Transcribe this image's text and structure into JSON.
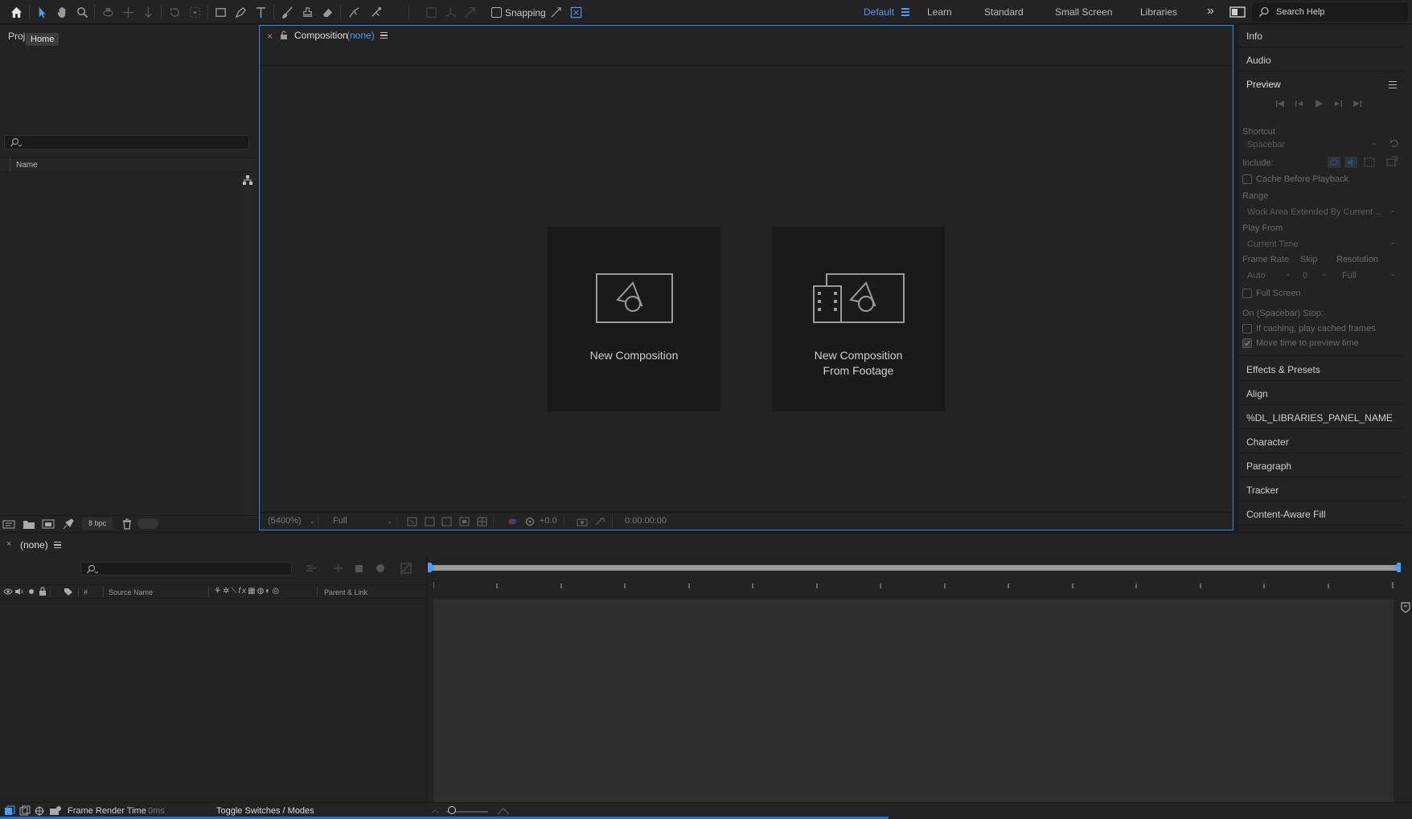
{
  "tooltip": "Home",
  "toolbar": {
    "snapping_label": "Snapping",
    "workspaces": [
      "Default",
      "Learn",
      "Standard",
      "Small Screen",
      "Libraries"
    ],
    "active_workspace": "Default",
    "search_placeholder": "Search Help"
  },
  "project": {
    "tab_label": "Proj",
    "column_name": "Name",
    "bpc_label": "8 bpc"
  },
  "composition": {
    "tab_label": "Composition",
    "tab_suffix": "(none)",
    "cards": [
      {
        "label_line1": "New Composition",
        "label_line2": ""
      },
      {
        "label_line1": "New Composition",
        "label_line2": "From Footage"
      }
    ],
    "footer": {
      "zoom": "(5400%)",
      "resolution": "Full",
      "exposure": "+0.0",
      "timecode": "0:00:00:00"
    }
  },
  "right_panels": {
    "top": [
      "Info",
      "Audio"
    ],
    "preview": {
      "title": "Preview",
      "shortcut_label": "Shortcut",
      "shortcut_value": "Spacebar",
      "include_label": "Include:",
      "cache_label": "Cache Before Playback",
      "range_label": "Range",
      "range_value": "Work Area Extended By Current ...",
      "play_from_label": "Play From",
      "play_from_value": "Current Time",
      "frame_rate_label": "Frame Rate",
      "skip_label": "Skip",
      "resolution_label": "Resolution",
      "frame_rate_value": "Auto",
      "skip_value": "0",
      "resolution_value": "Full",
      "full_screen_label": "Full Screen",
      "on_stop_label": "On (Spacebar) Stop:",
      "if_caching_label": "If caching, play cached frames",
      "move_time_label": "Move time to preview time"
    },
    "bottom": [
      "Effects & Presets",
      "Align",
      "%DL_LIBRARIES_PANEL_NAME",
      "Character",
      "Paragraph",
      "Tracker",
      "Content-Aware Fill"
    ]
  },
  "timeline": {
    "tab_label": "(none)",
    "col_hash": "#",
    "col_source": "Source Name",
    "col_parent": "Parent & Link",
    "frame_render_label": "Frame Render Time",
    "frame_render_value": "0ms",
    "toggle_label": "Toggle Switches / Modes"
  }
}
